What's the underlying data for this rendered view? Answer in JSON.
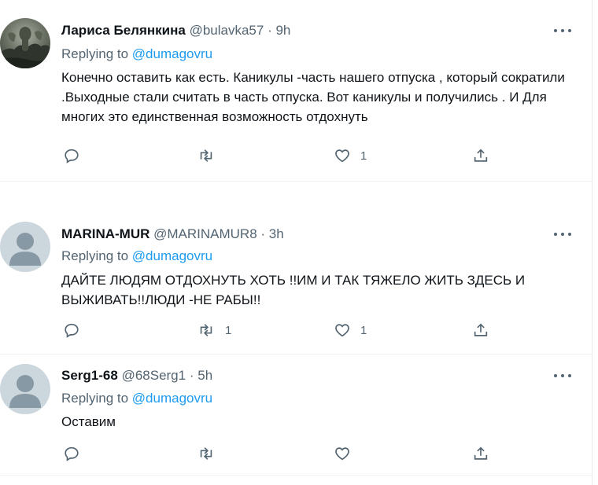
{
  "tweets": [
    {
      "name": "Лариса Белянкина",
      "handle": "@bulavka57",
      "dot": "·",
      "time": "9h",
      "replying_label": "Replying to",
      "replying_to": "@dumagovru",
      "text": "Конечно оставить как есть. Каникулы -часть нашего отпуска , который сократили .Выходные стали считать в часть отпуска. Вот каникулы и получились . И  Для многих это единственная возможность отдохнуть",
      "reply_count": "",
      "retweet_count": "",
      "like_count": "1",
      "avatar_icon": "photo-avatar"
    },
    {
      "name": "MARINA-MUR",
      "handle": "@MARINAMUR8",
      "dot": "·",
      "time": "3h",
      "replying_label": "Replying to",
      "replying_to": "@dumagovru",
      "text": "ДАЙТЕ ЛЮДЯМ ОТДОХНУТЬ ХОТЬ !!ИМ И ТАК ТЯЖЕЛО ЖИТЬ ЗДЕСЬ И ВЫЖИВАТЬ!!ЛЮДИ -НЕ РАБЫ!!",
      "reply_count": "",
      "retweet_count": "1",
      "like_count": "1",
      "avatar_icon": "default-avatar"
    },
    {
      "name": "Serg1-68",
      "handle": "@68Serg1",
      "dot": "·",
      "time": "5h",
      "replying_label": "Replying to",
      "replying_to": "@dumagovru",
      "text": "Оставим",
      "reply_count": "",
      "retweet_count": "",
      "like_count": "",
      "avatar_icon": "default-avatar"
    }
  ],
  "icons": {
    "reply": "reply-icon",
    "retweet": "retweet-icon",
    "like": "like-icon",
    "share": "share-icon",
    "more": "more-icon"
  },
  "colors": {
    "link": "#1d9bf0",
    "secondary": "#536471",
    "text": "#0f1419",
    "default_avatar_bg": "#ccd6dd"
  }
}
